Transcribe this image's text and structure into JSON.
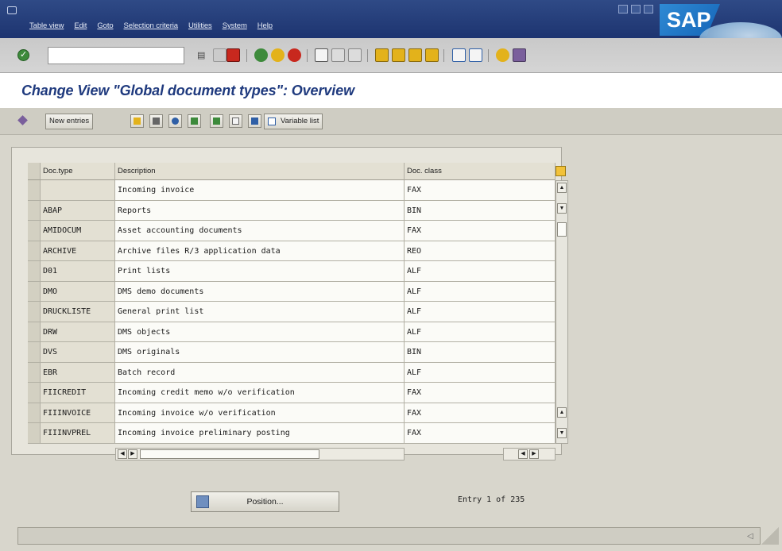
{
  "menubar": {
    "items": [
      "Table view",
      "Edit",
      "Goto",
      "Selection criteria",
      "Utilities",
      "System",
      "Help"
    ],
    "logo": "SAP"
  },
  "stdbar": {
    "command_value": "",
    "icons": [
      "enter-icon",
      "save-icon",
      "back-icon",
      "exit-icon",
      "cancel-icon",
      "print-icon",
      "find-icon",
      "find-next-icon",
      "first-page-icon",
      "prev-page-icon",
      "next-page-icon",
      "last-page-icon",
      "new-session-icon",
      "shortcut-icon",
      "help-icon",
      "layout-icon"
    ],
    "colors": {
      "green": "#3d8a3b",
      "yellow": "#e3b21b",
      "red": "#c8281e",
      "blue": "#2f5fa6"
    }
  },
  "title": "Change View \"Global document types\": Overview",
  "appbar": {
    "new_entries": "New entries",
    "variable_list": "Variable list"
  },
  "table": {
    "headers": [
      "Doc.type",
      "Description",
      "Doc. class"
    ],
    "rows": [
      {
        "type": "",
        "description": "Incoming invoice",
        "doc_class": "FAX"
      },
      {
        "type": "ABAP",
        "description": "Reports",
        "doc_class": "BIN"
      },
      {
        "type": "AMIDOCUM",
        "description": "Asset accounting documents",
        "doc_class": "FAX"
      },
      {
        "type": "ARCHIVE",
        "description": "Archive files R/3 application data",
        "doc_class": "REO"
      },
      {
        "type": "D01",
        "description": "Print lists",
        "doc_class": "ALF"
      },
      {
        "type": "DMO",
        "description": "DMS demo documents",
        "doc_class": "ALF"
      },
      {
        "type": "DRUCKLISTE",
        "description": "General print list",
        "doc_class": "ALF"
      },
      {
        "type": "DRW",
        "description": "DMS objects",
        "doc_class": "ALF"
      },
      {
        "type": "DVS",
        "description": "DMS originals",
        "doc_class": "BIN"
      },
      {
        "type": "EBR",
        "description": "Batch record",
        "doc_class": "ALF"
      },
      {
        "type": "FIICREDIT",
        "description": "Incoming credit memo w/o verification",
        "doc_class": "FAX"
      },
      {
        "type": "FIIINVOICE",
        "description": "Incoming invoice w/o verification",
        "doc_class": "FAX"
      },
      {
        "type": "FIIINVPREL",
        "description": "Incoming invoice preliminary posting",
        "doc_class": "FAX"
      }
    ]
  },
  "position_button": "Position...",
  "entry_info": "Entry 1 of 235"
}
